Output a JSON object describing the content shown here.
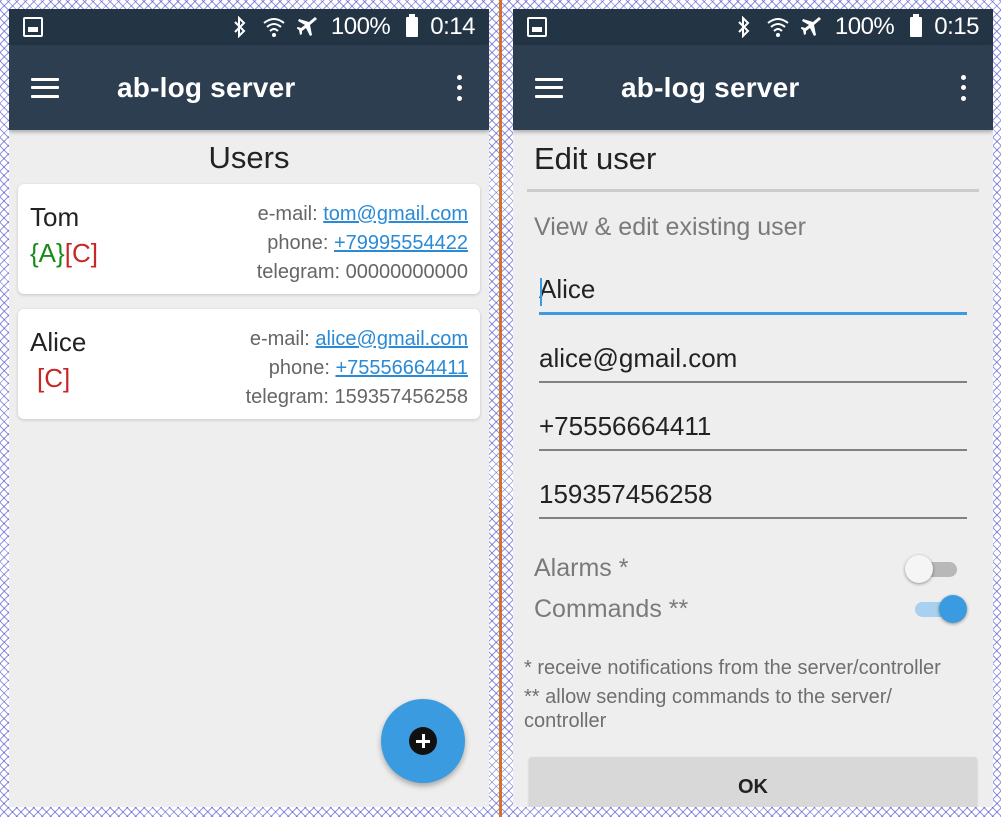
{
  "left_screen": {
    "status": {
      "battery": "100%",
      "time": "0:14"
    },
    "app_title": "ab-log server",
    "page_title": "Users",
    "users": [
      {
        "name": "Tom",
        "role_a": "{A}",
        "role_c": "[C]",
        "email_label": "e-mail:",
        "email": "tom@gmail.com",
        "phone_label": "phone:",
        "phone": "+79995554422",
        "telegram_label": "telegram:",
        "telegram": "00000000000"
      },
      {
        "name": "Alice",
        "role_a": "",
        "role_c": "[C]",
        "email_label": "e-mail:",
        "email": "alice@gmail.com",
        "phone_label": "phone:",
        "phone": "+75556664411",
        "telegram_label": "telegram:",
        "telegram": "159357456258"
      }
    ]
  },
  "right_screen": {
    "status": {
      "battery": "100%",
      "time": "0:15"
    },
    "app_title": "ab-log server",
    "page_title": "Edit user",
    "subtitle": "View & edit existing user",
    "fields": {
      "name": "Alice",
      "email": "alice@gmail.com",
      "phone": "+75556664411",
      "telegram": "159357456258"
    },
    "toggles": {
      "alarms_label": "Alarms *",
      "alarms_on": false,
      "commands_label": "Commands **",
      "commands_on": true
    },
    "notes": {
      "note1": "* receive notifications from the server/controller",
      "note2": "** allow sending commands to the server/ controller"
    },
    "ok_label": "OK"
  },
  "colors": {
    "statusbar": "#233545",
    "appbar": "#2c3e50",
    "accent": "#3b9be0",
    "role_a": "#1a8a1a",
    "role_c": "#c62828",
    "link": "#2a8ad6"
  }
}
